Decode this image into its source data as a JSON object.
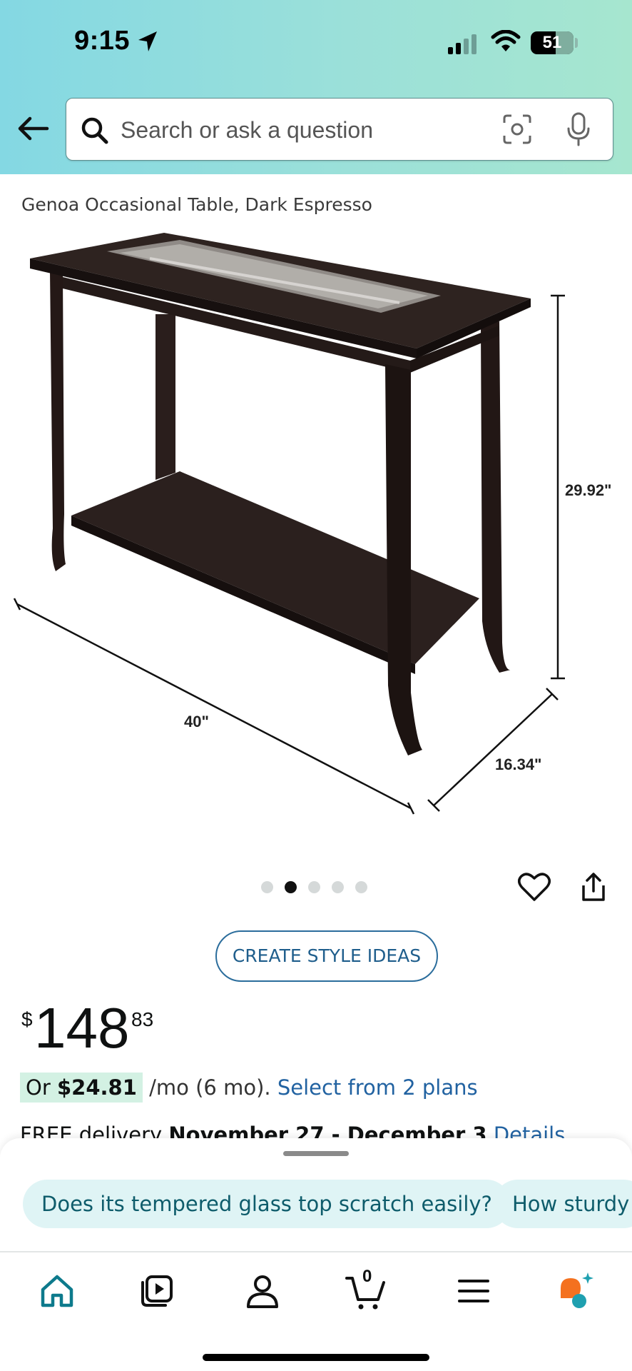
{
  "status_bar": {
    "time": "9:15",
    "battery": "51"
  },
  "search": {
    "placeholder": "Search or ask a question"
  },
  "product": {
    "title": "Genoa Occasional Table, Dark Espresso",
    "dimensions": {
      "height": "29.92\"",
      "width": "40\"",
      "depth": "16.34\""
    },
    "image_count": 5,
    "active_image_index": 2
  },
  "style_button_label": "CREATE STYLE IDEAS",
  "price": {
    "symbol": "$",
    "whole": "148",
    "fraction": "83"
  },
  "installment": {
    "prefix": "Or ",
    "amount": "$24.81",
    "suffix": " /mo (6 mo). ",
    "link": "Select from 2 plans"
  },
  "delivery": {
    "prefix": "FREE delivery ",
    "dates": "November 27 - December 3",
    "link": "Details"
  },
  "rufus_suggestions": [
    "Does its tempered glass top scratch easily?",
    "How sturdy"
  ],
  "bottom_nav": {
    "cart_count": "0",
    "items": [
      "home-icon",
      "play-icon",
      "account-icon",
      "cart-icon",
      "menu-icon",
      "rufus-icon"
    ]
  },
  "colors": {
    "accent_link": "#2162a1",
    "chip_bg": "#dff4f5",
    "chip_text": "#0e5c6b",
    "header_gradient_start": "#84d8e3",
    "header_gradient_end": "#a6e6cf"
  }
}
